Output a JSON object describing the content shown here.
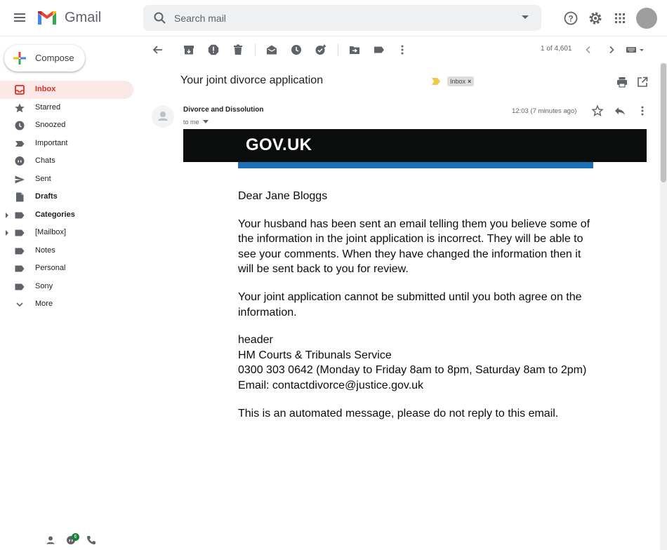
{
  "app": {
    "name": "Gmail"
  },
  "search": {
    "placeholder": "Search mail"
  },
  "compose": {
    "label": "Compose"
  },
  "sidebar": {
    "items": [
      {
        "label": "Inbox",
        "icon": "inbox-icon",
        "active": true
      },
      {
        "label": "Starred",
        "icon": "star-icon"
      },
      {
        "label": "Snoozed",
        "icon": "clock-icon"
      },
      {
        "label": "Important",
        "icon": "important-icon"
      },
      {
        "label": "Chats",
        "icon": "chat-icon"
      },
      {
        "label": "Sent",
        "icon": "send-icon"
      },
      {
        "label": "Drafts",
        "icon": "draft-icon",
        "bold": true
      },
      {
        "label": "Categories",
        "icon": "label-icon",
        "bold": true,
        "expandable": true
      },
      {
        "label": "[Mailbox]",
        "icon": "label-icon",
        "expandable": true
      },
      {
        "label": "Notes",
        "icon": "label-icon"
      },
      {
        "label": "Personal",
        "icon": "label-icon"
      },
      {
        "label": "Sony",
        "icon": "label-icon"
      },
      {
        "label": "More",
        "icon": "chevron-down-icon"
      }
    ],
    "chat_badge": "6"
  },
  "toolbar": {
    "pager": "1 of 4,601"
  },
  "email": {
    "subject": "Your joint divorce application",
    "label_chip": "Inbox",
    "chip_close": "×",
    "sender": "Divorce and Dissolution",
    "recipient": "to me",
    "time": "12:03 (7 minutes ago)",
    "banner_text": "GOV.UK",
    "greeting": "Dear Jane Bloggs",
    "paragraph1": "Your husband has been sent an email telling them you believe some of the information in the joint application is incorrect. They will be able to see your comments. When they have changed the information then it will be sent back to you for review.",
    "paragraph2": "Your joint application cannot be submitted until you both agree on the information.",
    "contact": {
      "line1": "header",
      "line2": "HM Courts & Tribunals Service",
      "line3": "0300 303 0642 (Monday to Friday 8am to 8pm, Saturday 8am to 2pm)",
      "line4": "Email: contactdivorce@justice.gov.uk"
    },
    "footer": "This is an automated message, please do not reply to this email."
  },
  "colors": {
    "active_bg": "#fce8e6",
    "active_text": "#d93025",
    "gov_banner": "#0b0c0c",
    "gov_stripe": "#1d70b8"
  }
}
